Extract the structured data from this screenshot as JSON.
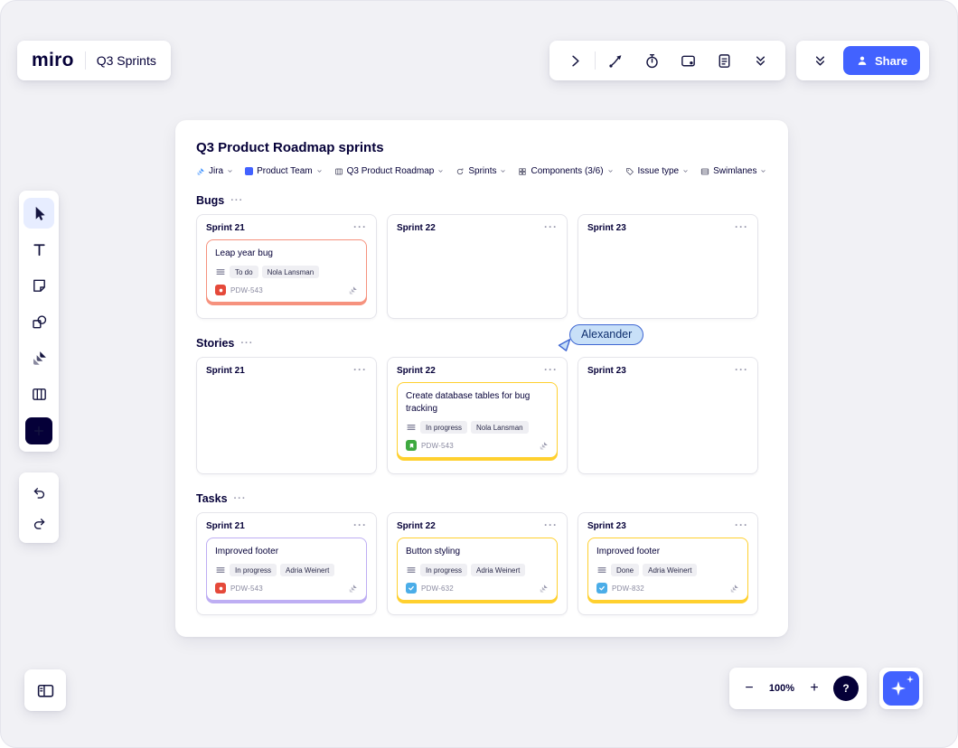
{
  "colors": {
    "accent_blue": "#4262FF",
    "navy_text": "#050038",
    "canvas_bg": "#F1F1F5",
    "bug_type_red": "#E5493A",
    "story_type_green": "#3EA940",
    "task_type_blue": "#4BADE8",
    "card_border_salmon": "#F6927E",
    "card_border_yellow": "#FFD02F",
    "card_border_purple": "#BEAEF3",
    "cursor_bubble_bg": "#C8E0F8",
    "cursor_bubble_border": "#3E66D2"
  },
  "header": {
    "logo": "miro",
    "board_title": "Q3 Sprints",
    "share_label": "Share"
  },
  "top_toolbar": {
    "icons": [
      "chevron-right",
      "connector-pen",
      "timer",
      "frame",
      "notes",
      "double-chevron-down"
    ]
  },
  "right_toolbar": {
    "icons": [
      "double-chevron-down"
    ]
  },
  "left_toolbar": {
    "selected_tool": "select",
    "tools": [
      "select",
      "text",
      "sticky-note",
      "shapes",
      "jira",
      "frames-kanban",
      "add-more"
    ],
    "history": [
      "undo",
      "redo"
    ]
  },
  "board": {
    "title": "Q3 Product Roadmap sprints",
    "filters": [
      {
        "label": "Jira",
        "icon": "jira-logo"
      },
      {
        "label": "Product Team",
        "icon": "team-avatar"
      },
      {
        "label": "Q3 Product Roadmap",
        "icon": "board-columns"
      },
      {
        "label": "Sprints",
        "icon": "sprint-loop"
      },
      {
        "label": "Components (3/6)",
        "icon": "components-grid"
      },
      {
        "label": "Issue type",
        "icon": "issue-tag"
      },
      {
        "label": "Swimlanes",
        "icon": "swimlane-rows"
      }
    ],
    "lanes": [
      {
        "name": "Bugs",
        "menu": "···",
        "columns": [
          {
            "title": "Sprint 21",
            "menu": "···",
            "cards": [
              {
                "title": "Leap year bug",
                "status": "To do",
                "assignee": "Nola Lansman",
                "key": "PDW-543",
                "type": "bug",
                "accent": "salmon"
              }
            ]
          },
          {
            "title": "Sprint 22",
            "menu": "···",
            "cards": []
          },
          {
            "title": "Sprint 23",
            "menu": "···",
            "cards": []
          }
        ]
      },
      {
        "name": "Stories",
        "menu": "···",
        "columns": [
          {
            "title": "Sprint 21",
            "menu": "···",
            "cards": []
          },
          {
            "title": "Sprint 22",
            "menu": "···",
            "cards": [
              {
                "title": "Create database tables for bug tracking",
                "status": "In progress",
                "assignee": "Nola Lansman",
                "key": "PDW-543",
                "type": "story",
                "accent": "yellow"
              }
            ]
          },
          {
            "title": "Sprint 23",
            "menu": "···",
            "cards": []
          }
        ]
      },
      {
        "name": "Tasks",
        "menu": "···",
        "columns": [
          {
            "title": "Sprint 21",
            "menu": "···",
            "cards": [
              {
                "title": "Improved footer",
                "status": "In progress",
                "assignee": "Adria Weinert",
                "key": "PDW-543",
                "type": "bug",
                "accent": "purple"
              }
            ]
          },
          {
            "title": "Sprint 22",
            "menu": "···",
            "cards": [
              {
                "title": "Button styling",
                "status": "In progress",
                "assignee": "Adria Weinert",
                "key": "PDW-632",
                "type": "task",
                "accent": "yellow"
              }
            ]
          },
          {
            "title": "Sprint 23",
            "menu": "···",
            "cards": [
              {
                "title": "Improved footer",
                "status": "Done",
                "assignee": "Adria Weinert",
                "key": "PDW-832",
                "type": "task",
                "accent": "yellow"
              }
            ]
          }
        ]
      }
    ]
  },
  "collaborator_cursor": {
    "name": "Alexander"
  },
  "footer": {
    "zoom_out": "−",
    "zoom_level": "100%",
    "zoom_in": "+",
    "help": "?"
  }
}
